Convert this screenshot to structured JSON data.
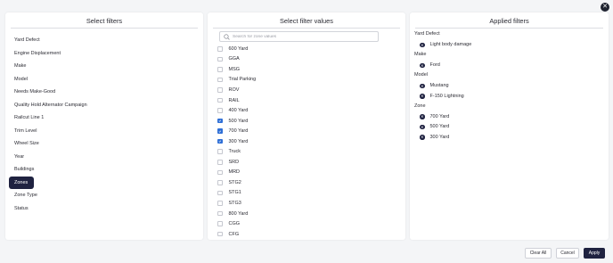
{
  "panels": {
    "select_filters_title": "Select filters",
    "select_values_title": "Select filter values",
    "applied_filters_title": "Applied filters"
  },
  "filters": [
    {
      "label": "Yard Defect",
      "active": false
    },
    {
      "label": "Engine Displacement",
      "active": false
    },
    {
      "label": "Make",
      "active": false
    },
    {
      "label": "Model",
      "active": false
    },
    {
      "label": "Needs Make-Good",
      "active": false
    },
    {
      "label": "Quality Hold Alternator Campaign",
      "active": false
    },
    {
      "label": "Railcut Line 1",
      "active": false
    },
    {
      "label": "Trim Level",
      "active": false
    },
    {
      "label": "Wheel Size",
      "active": false
    },
    {
      "label": "Year",
      "active": false
    },
    {
      "label": "Buildings",
      "active": false
    },
    {
      "label": "Zones",
      "active": true
    },
    {
      "label": "Zone Type",
      "active": false
    },
    {
      "label": "Status",
      "active": false
    }
  ],
  "search": {
    "placeholder": "Search for zone values",
    "value": ""
  },
  "values": [
    {
      "label": "600 Yard",
      "checked": false
    },
    {
      "label": "GGA",
      "checked": false
    },
    {
      "label": "MSG",
      "checked": false
    },
    {
      "label": "Trial Parking",
      "checked": false
    },
    {
      "label": "ROV",
      "checked": false
    },
    {
      "label": "RAIL",
      "checked": false
    },
    {
      "label": "400 Yard",
      "checked": false
    },
    {
      "label": "500 Yard",
      "checked": true
    },
    {
      "label": "700 Yard",
      "checked": true
    },
    {
      "label": "300 Yard",
      "checked": true
    },
    {
      "label": "Truck",
      "checked": false
    },
    {
      "label": "SRD",
      "checked": false
    },
    {
      "label": "MRD",
      "checked": false
    },
    {
      "label": "STG2",
      "checked": false
    },
    {
      "label": "STG1",
      "checked": false
    },
    {
      "label": "STG3",
      "checked": false
    },
    {
      "label": "800 Yard",
      "checked": false
    },
    {
      "label": "CGG",
      "checked": false
    },
    {
      "label": "CFG",
      "checked": false
    }
  ],
  "applied": [
    {
      "group": "Yard Defect",
      "items": [
        "Light body damage"
      ]
    },
    {
      "group": "Make",
      "items": [
        "Ford"
      ]
    },
    {
      "group": "Model",
      "items": [
        "Mustang",
        "F-150 Lightning"
      ]
    },
    {
      "group": "Zone",
      "items": [
        "700 Yard",
        "500 Yard",
        "300 Yard"
      ]
    }
  ],
  "buttons": {
    "clear_all": "Clear All",
    "cancel": "Cancel",
    "apply": "Apply",
    "close_glyph": "✕",
    "remove_glyph": "✕"
  },
  "colors": {
    "accent": "#1f2240",
    "checkbox_checked": "#2f6fd6",
    "background": "#f4f5f7"
  },
  "icons": {
    "search": "search-icon",
    "close": "close-icon",
    "remove": "remove-chip-icon",
    "check": "check-icon"
  }
}
